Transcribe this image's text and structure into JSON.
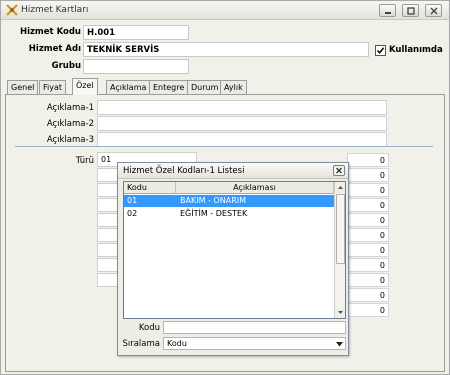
{
  "window": {
    "title": "Hizmet Kartları"
  },
  "header": {
    "kod_label": "Hizmet Kodu",
    "kod_value": "H.001",
    "adi_label": "Hizmet Adı",
    "adi_value": "TEKNİK SERVİS",
    "grubu_label": "Grubu",
    "grubu_value": "",
    "kullanimda_label": "Kullanımda",
    "kullanimda_checked": true
  },
  "tabs": [
    {
      "label": "Genel"
    },
    {
      "label": "Fiyat"
    },
    {
      "label": "Özel"
    },
    {
      "label": "Açıklama"
    },
    {
      "label": "Entegre"
    },
    {
      "label": "Durum"
    },
    {
      "label": "Aylık"
    }
  ],
  "active_tab": "Özel",
  "ozel": {
    "aciklama1_label": "Açıklama-1",
    "aciklama2_label": "Açıklama-2",
    "aciklama3_label": "Açıklama-3",
    "turu_label": "Türü",
    "turu_value": "01",
    "numeric_values": [
      "0",
      "0",
      "0",
      "0",
      "0",
      "0",
      "0",
      "0",
      "0",
      "0",
      "0"
    ]
  },
  "popup": {
    "title": "Hizmet Özel Kodları-1 Listesi",
    "columns": [
      "Kodu",
      "Açıklaması"
    ],
    "rows": [
      {
        "kodu": "01",
        "aciklama": "BAKIM - ONARIM",
        "selected": true
      },
      {
        "kodu": "02",
        "aciklama": "EĞİTİM - DESTEK",
        "selected": false
      }
    ],
    "kodu_label": "Kodu",
    "kodu_value": "",
    "siralama_label": "Sıralama",
    "siralama_value": "Kodu"
  },
  "colors": {
    "selection": "#3399ff",
    "window_bg": "#f1f0e9"
  },
  "icons": {
    "app": "app-logo-icon",
    "minimize": "minimize-icon",
    "maximize": "maximize-icon",
    "close": "close-icon"
  }
}
